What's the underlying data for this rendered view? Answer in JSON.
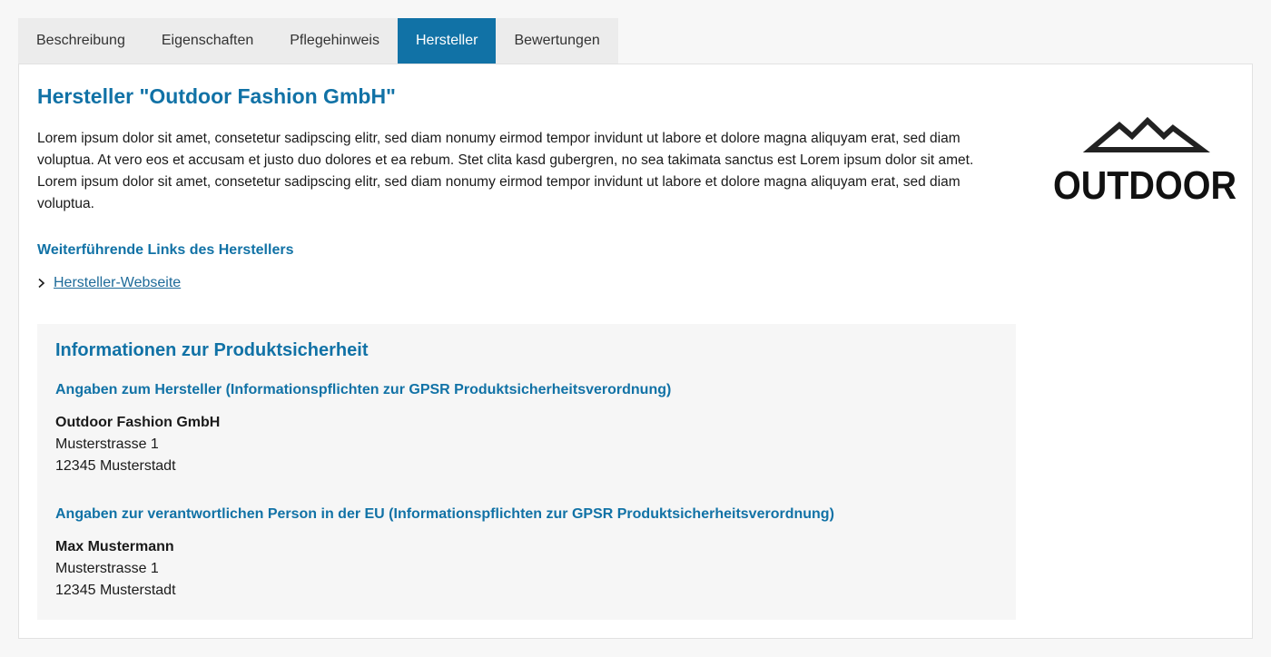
{
  "tabs": [
    {
      "label": "Beschreibung",
      "active": false
    },
    {
      "label": "Eigenschaften",
      "active": false
    },
    {
      "label": "Pflegehinweis",
      "active": false
    },
    {
      "label": "Hersteller",
      "active": true
    },
    {
      "label": "Bewertungen",
      "active": false
    }
  ],
  "manufacturer": {
    "title": "Hersteller \"Outdoor Fashion GmbH\"",
    "description": "Lorem ipsum dolor sit amet, consetetur sadipscing elitr, sed diam nonumy eirmod tempor invidunt ut labore et dolore magna aliquyam erat, sed diam voluptua. At vero eos et accusam et justo duo dolores et ea rebum. Stet clita kasd gubergren, no sea takimata sanctus est Lorem ipsum dolor sit amet. Lorem ipsum dolor sit amet, consetetur sadipscing elitr, sed diam nonumy eirmod tempor invidunt ut labore et dolore magna aliquyam erat, sed diam voluptua.",
    "links_heading": "Weiterführende Links des Herstellers",
    "website_link": "Hersteller-Webseite",
    "logo_text": "OUTDOOR"
  },
  "safety": {
    "heading": "Informationen zur Produktsicherheit",
    "manufacturer_heading": "Angaben zum Hersteller (Informationspflichten zur GPSR Produktsicherheitsverordnung)",
    "manufacturer_address": {
      "name": "Outdoor Fashion GmbH",
      "street": "Musterstrasse 1",
      "city": "12345 Musterstadt"
    },
    "person_heading": "Angaben zur verantwortlichen Person in der EU (Informationspflichten zur GPSR Produktsicherheitsverordnung)",
    "person_address": {
      "name": "Max Mustermann",
      "street": "Musterstrasse 1",
      "city": "12345 Musterstadt"
    }
  },
  "colors": {
    "accent": "#1172a6",
    "tab_bar": "#ececec",
    "safety_box": "#f6f6f6"
  }
}
